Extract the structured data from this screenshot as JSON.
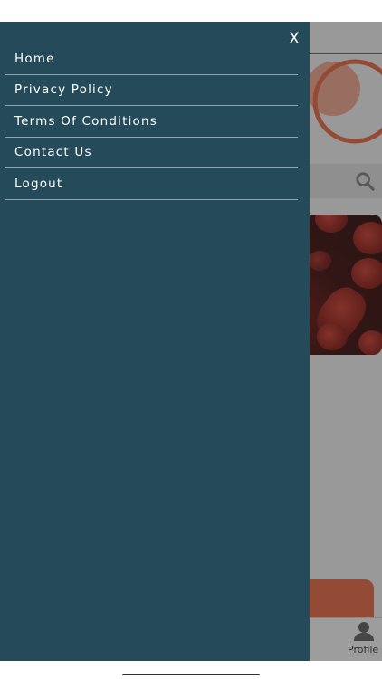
{
  "drawer": {
    "close_label": "X",
    "items": [
      {
        "label": "Home"
      },
      {
        "label": "Privacy Policy"
      },
      {
        "label": "Terms Of Conditions"
      },
      {
        "label": "Contact Us"
      },
      {
        "label": "Logout"
      }
    ]
  },
  "background": {
    "tabbar": {
      "profile_label": "Profile",
      "profile_icon": "person-icon"
    },
    "search_icon": "search-icon"
  },
  "colors": {
    "drawer_bg": "#254b5b",
    "divider": "#8fa7b2",
    "accent_orange": "#e0653f"
  }
}
